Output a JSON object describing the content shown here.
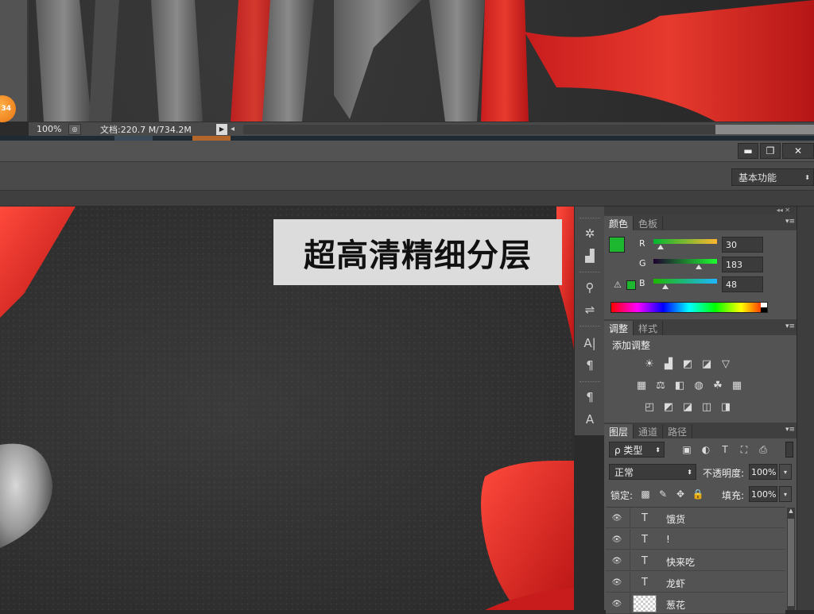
{
  "status_bar": {
    "zoom": "100%",
    "doc_info": "文档:220.7 M/734.2M",
    "nav_arrow": "▶",
    "scroll_left": "◂"
  },
  "badge": {
    "text": "34"
  },
  "window_controls": {
    "minimize": "▬",
    "restore": "❐",
    "close": "✕"
  },
  "workspace": {
    "label": "基本功能",
    "caret": "⬍"
  },
  "canvas": {
    "banner_text": "超高清精细分层"
  },
  "panel_topbar": {
    "collapse": "◂◂  ✕"
  },
  "dock_icons": [
    {
      "name": "navigator-icon",
      "glyph": "✲"
    },
    {
      "name": "histogram-icon",
      "glyph": "▟"
    },
    {
      "name": "brush-presets-icon",
      "glyph": "⚲"
    },
    {
      "name": "tool-presets-icon",
      "glyph": "⇌"
    },
    {
      "name": "character-icon",
      "glyph": "A|"
    },
    {
      "name": "paragraph-icon",
      "glyph": "¶"
    },
    {
      "name": "paragraph-styles-icon",
      "glyph": "¶"
    },
    {
      "name": "character-styles-icon",
      "glyph": "A"
    }
  ],
  "color_panel": {
    "tabs": [
      "颜色",
      "色板"
    ],
    "foreground_color": "#1eb730",
    "background_color": "#ffffff",
    "warning_icon": "⚠",
    "channels": [
      {
        "label": "R",
        "value": "30",
        "fraction": 0.118
      },
      {
        "label": "G",
        "value": "183",
        "fraction": 0.718
      },
      {
        "label": "B",
        "value": "48",
        "fraction": 0.188
      }
    ]
  },
  "adjust_panel": {
    "tabs": [
      "调整",
      "样式"
    ],
    "heading": "添加调整",
    "row1": [
      "☀",
      "▟",
      "◩",
      "◪",
      "▽"
    ],
    "row2": [
      "▦",
      "⚖",
      "◧",
      "◍",
      "☘",
      "▦"
    ],
    "row3": [
      "◰",
      "◩",
      "◪",
      "◫",
      "◨"
    ]
  },
  "layers_panel": {
    "tabs": [
      "图层",
      "通道",
      "路径"
    ],
    "filter_type": "ρ 类型",
    "filter_icons": [
      "▣",
      "◐",
      "T",
      "⛶",
      "⎙"
    ],
    "blend_mode": "正常",
    "opacity_label": "不透明度:",
    "opacity_value": "100%",
    "lock_label": "锁定:",
    "lock_icons": [
      "▩",
      "✎",
      "✥",
      "🔒"
    ],
    "fill_label": "填充:",
    "fill_value": "100%",
    "layers": [
      {
        "name": "饿货",
        "kind": "T"
      },
      {
        "name": "!",
        "kind": "T"
      },
      {
        "name": "快来吃",
        "kind": "T"
      },
      {
        "name": "龙虾",
        "kind": "T"
      },
      {
        "name": "葱花",
        "kind": "pixel"
      }
    ]
  }
}
